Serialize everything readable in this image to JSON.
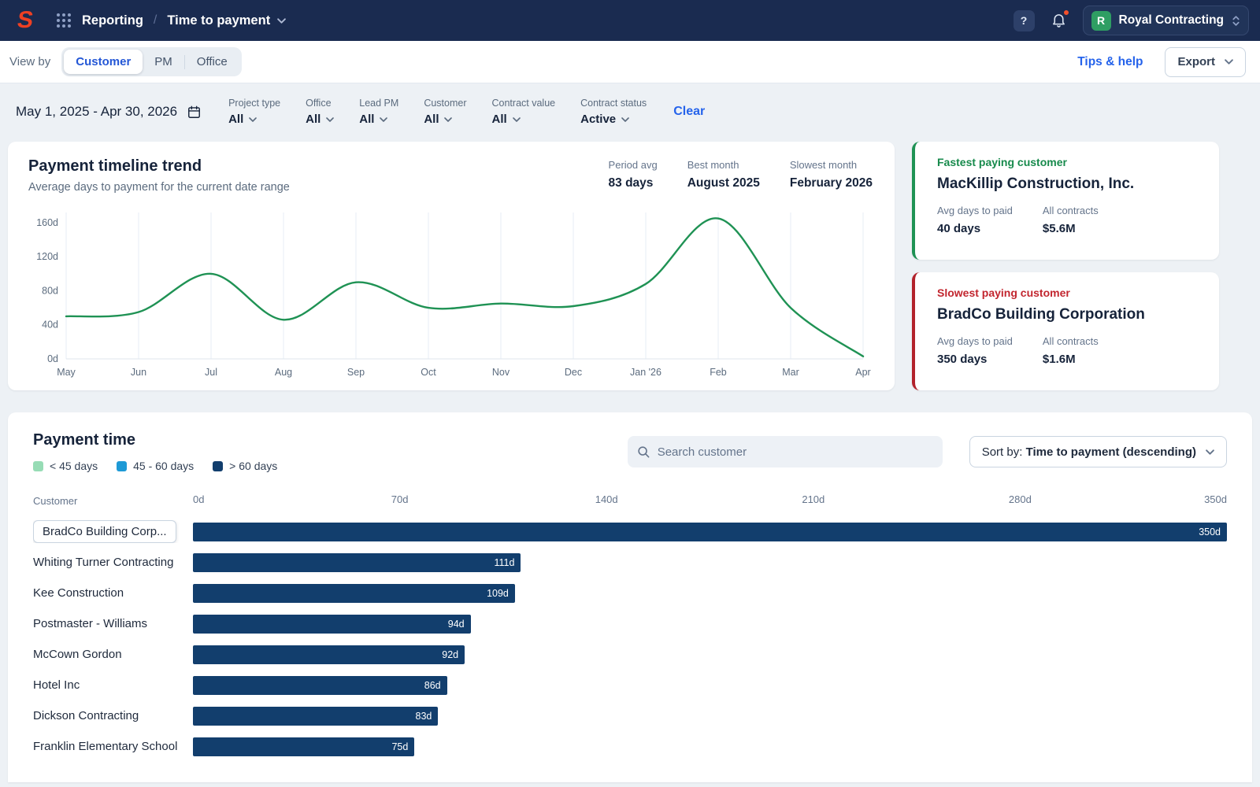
{
  "topnav": {
    "section": "Reporting",
    "separator": "/",
    "page": "Time to payment",
    "account": {
      "initial": "R",
      "name": "Royal Contracting"
    }
  },
  "viewbar": {
    "view_by_label": "View by",
    "segments": [
      {
        "label": "Customer",
        "active": true
      },
      {
        "label": "PM",
        "active": false
      },
      {
        "label": "Office",
        "active": false
      }
    ],
    "tips_link": "Tips & help",
    "export_label": "Export"
  },
  "filters": {
    "date_range": "May 1, 2025 - Apr 30, 2026",
    "clear_label": "Clear",
    "items": [
      {
        "label": "Project type",
        "value": "All"
      },
      {
        "label": "Office",
        "value": "All"
      },
      {
        "label": "Lead PM",
        "value": "All"
      },
      {
        "label": "Customer",
        "value": "All"
      },
      {
        "label": "Contract value",
        "value": "All"
      },
      {
        "label": "Contract status",
        "value": "Active"
      }
    ]
  },
  "trend": {
    "title": "Payment timeline trend",
    "subtitle": "Average days to payment for the current date range",
    "stats": [
      {
        "label": "Period avg",
        "value": "83 days"
      },
      {
        "label": "Best month",
        "value": "August 2025"
      },
      {
        "label": "Slowest month",
        "value": "February 2026"
      }
    ]
  },
  "highlights": {
    "fastest": {
      "label": "Fastest paying customer",
      "name": "MacKillip Construction, Inc.",
      "avg_label": "Avg days to paid",
      "avg_value": "40 days",
      "contracts_label": "All contracts",
      "contracts_value": "$5.6M",
      "accent_color": "#1f9254"
    },
    "slowest": {
      "label": "Slowest paying customer",
      "name": "BradCo Building Corporation",
      "avg_label": "Avg days to paid",
      "avg_value": "350 days",
      "contracts_label": "All contracts",
      "contracts_value": "$1.6M",
      "accent_color": "#b2222b"
    }
  },
  "payment_time": {
    "title": "Payment time",
    "legend": [
      {
        "label": "< 45 days",
        "color": "#97dcb5"
      },
      {
        "label": "45 - 60 days",
        "color": "#1e9ad6"
      },
      {
        "label": "> 60 days",
        "color": "#123e6d"
      }
    ],
    "search_placeholder": "Search customer",
    "sort_prefix": "Sort by:",
    "sort_value": "Time to payment (descending)",
    "column_header": "Customer"
  },
  "chart_data": [
    {
      "type": "line",
      "title": "Payment timeline trend",
      "x": [
        "May",
        "Jun",
        "Jul",
        "Aug",
        "Sep",
        "Oct",
        "Nov",
        "Dec",
        "Jan '26",
        "Feb",
        "Mar",
        "Apr"
      ],
      "values": [
        50,
        55,
        100,
        46,
        90,
        60,
        65,
        62,
        88,
        165,
        60,
        3
      ],
      "y_ticks": [
        0,
        40,
        80,
        120,
        160
      ],
      "y_tick_suffix": "d",
      "ylim": [
        0,
        172
      ],
      "line_color": "#1f9254",
      "grid": true,
      "legend_position": "none"
    },
    {
      "type": "bar",
      "orientation": "horizontal",
      "categories": [
        "BradCo Building Corp...",
        "Whiting Turner Contracting",
        "Kee Construction",
        "Postmaster - Williams",
        "McCown Gordon",
        "Hotel Inc",
        "Dickson Contracting",
        "Franklin Elementary School"
      ],
      "values": [
        350,
        111,
        109,
        94,
        92,
        86,
        83,
        75
      ],
      "unit": "d",
      "x_ticks": [
        0,
        70,
        140,
        210,
        280,
        350
      ],
      "xlim": [
        0,
        350
      ],
      "bar_color": "#123e6d",
      "highlighted_row": 0
    }
  ]
}
